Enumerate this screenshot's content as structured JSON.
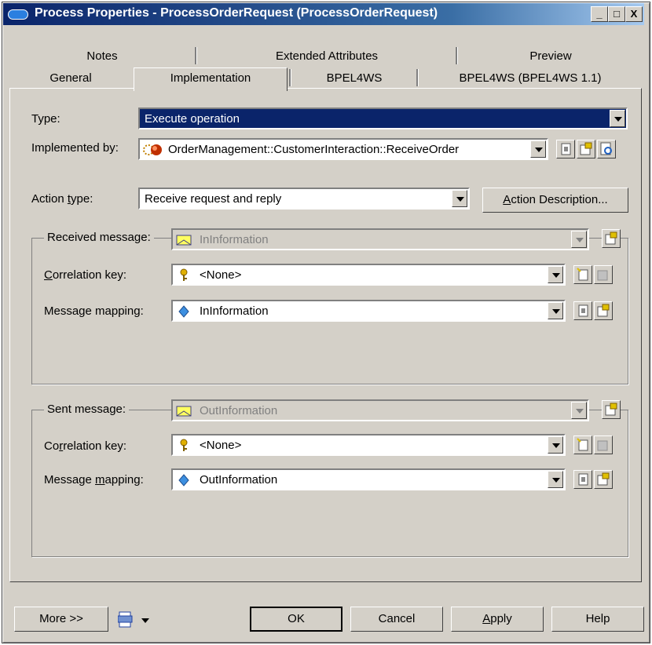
{
  "window": {
    "title": "Process Properties - ProcessOrderRequest (ProcessOrderRequest)",
    "controls": [
      "_",
      "□",
      "X"
    ]
  },
  "tabs": {
    "row1": [
      "Notes",
      "Extended Attributes",
      "Preview"
    ],
    "row2": [
      "General",
      "Implementation",
      "BPEL4WS",
      "BPEL4WS (BPEL4WS 1.1)"
    ],
    "active": "Implementation"
  },
  "form": {
    "type_label": "Type:",
    "type_value": "Execute operation",
    "implemented_by_label": "Implemented by:",
    "implemented_by_value": "OrderManagement::CustomerInteraction::ReceiveOrder",
    "action_type_label": "Action type:",
    "action_type_value": "Receive request and reply",
    "action_description_button": "Action Description..."
  },
  "received": {
    "group_label": "Received message:",
    "message_value": "InInformation",
    "correlation_label": "Correlation key:",
    "correlation_value": "<None>",
    "mapping_label": "Message mapping:",
    "mapping_value": "InInformation"
  },
  "sent": {
    "group_label": "Sent message:",
    "message_value": "OutInformation",
    "correlation_label": "Correlation key:",
    "correlation_value": "<None>",
    "mapping_label": "Message mapping:",
    "mapping_value": "OutInformation"
  },
  "footer": {
    "more": "More >>",
    "ok": "OK",
    "cancel": "Cancel",
    "apply": "Apply",
    "help": "Help"
  },
  "colors": {
    "title_bar": "#0a246a",
    "face": "#d4d0c8",
    "selection": "#0a246a"
  }
}
